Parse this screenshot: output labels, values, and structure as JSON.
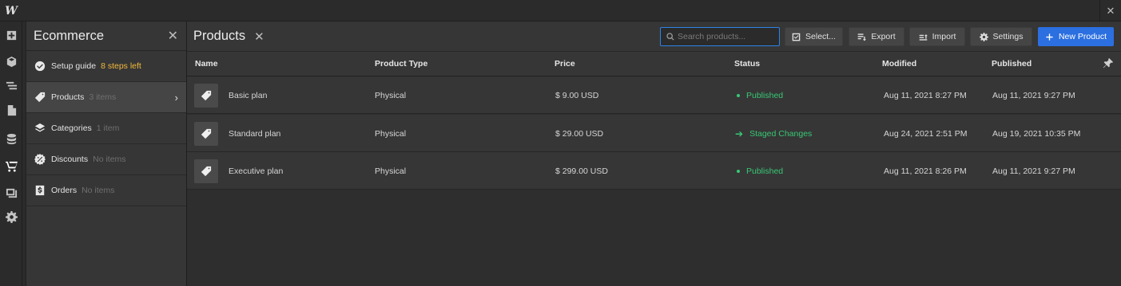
{
  "app": {
    "logo": "W",
    "close_glyph": "✕"
  },
  "leftbar": {
    "icons": [
      "add-icon",
      "box-icon",
      "navigator-icon",
      "pages-icon",
      "cms-icon",
      "ecommerce-icon",
      "assets-icon",
      "settings-icon"
    ]
  },
  "panel": {
    "title": "Ecommerce",
    "close_glyph": "✕",
    "items": [
      {
        "label": "Setup guide",
        "sub": "8 steps left",
        "icon": "check-circle-icon"
      },
      {
        "label": "Products",
        "sub": "3 items",
        "icon": "tag-icon"
      },
      {
        "label": "Categories",
        "sub": "1 item",
        "icon": "layers-icon"
      },
      {
        "label": "Discounts",
        "sub": "No items",
        "icon": "discount-icon"
      },
      {
        "label": "Orders",
        "sub": "No items",
        "icon": "receipt-icon"
      }
    ],
    "chevron": "›"
  },
  "main": {
    "title": "Products",
    "close_glyph": "✕",
    "search": {
      "placeholder": "Search products...",
      "value": ""
    },
    "buttons": {
      "select": "Select...",
      "export": "Export",
      "import": "Import",
      "settings": "Settings",
      "new_product": "New Product"
    },
    "columns": [
      "Name",
      "Product Type",
      "Price",
      "Status",
      "Modified",
      "Published"
    ],
    "rows": [
      {
        "name": "Basic plan",
        "type": "Physical",
        "price": "$ 9.00 USD",
        "status": "Published",
        "status_kind": "published",
        "modified": "Aug 11, 2021 8:27 PM",
        "published": "Aug 11, 2021 9:27 PM"
      },
      {
        "name": "Standard plan",
        "type": "Physical",
        "price": "$ 29.00 USD",
        "status": "Staged Changes",
        "status_kind": "staged",
        "modified": "Aug 24, 2021 2:51 PM",
        "published": "Aug 19, 2021 10:35 PM"
      },
      {
        "name": "Executive plan",
        "type": "Physical",
        "price": "$ 299.00 USD",
        "status": "Published",
        "status_kind": "published",
        "modified": "Aug 11, 2021 8:26 PM",
        "published": "Aug 11, 2021 9:27 PM"
      }
    ]
  },
  "colors": {
    "accent": "#2b6fe0",
    "status_green": "#38c774",
    "warning": "#f2b93b"
  }
}
